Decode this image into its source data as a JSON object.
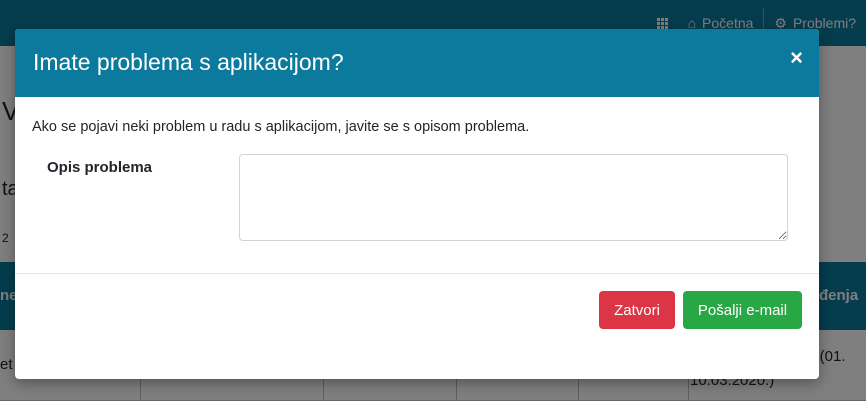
{
  "nav": {
    "home_label": "Početna",
    "problems_label": "Problemi?"
  },
  "background": {
    "heading_fragment": "V",
    "sub_fragment": "ta",
    "small_fragment": "2",
    "table_head_left": "ne",
    "table_head_right": "đenja",
    "row_left": "et",
    "row_right_line1": "et (01.",
    "row_right_line2": "10.03.2020.)"
  },
  "modal": {
    "title": "Imate problema s aplikacijom?",
    "close_symbol": "×",
    "intro_text": "Ako se pojavi neki problem u radu s aplikacijom, javite se s opisom problema.",
    "field_label": "Opis problema",
    "field_value": "",
    "close_button": "Zatvori",
    "send_button": "Pošalji e-mail"
  },
  "colors": {
    "header": "#0b7a9c",
    "danger": "#dc3545",
    "success": "#28a745"
  }
}
